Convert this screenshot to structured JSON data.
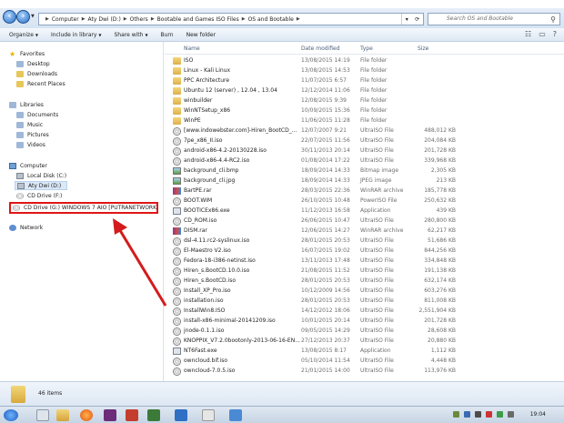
{
  "address": {
    "crumbs": [
      "Computer",
      "Aty Dwi (D:)",
      "Others",
      "Bootable and Games ISO Files",
      "OS and Bootable"
    ],
    "search_placeholder": "Search OS and Bootable"
  },
  "toolbar": {
    "organize": "Organize",
    "include_in_library": "Include in library",
    "share_with": "Share with",
    "burn": "Burn",
    "new_folder": "New folder"
  },
  "nav": {
    "favorites": "Favorites",
    "desktop": "Desktop",
    "downloads": "Downloads",
    "recent_places": "Recent Places",
    "libraries": "Libraries",
    "documents": "Documents",
    "music": "Music",
    "pictures": "Pictures",
    "videos": "Videos",
    "computer": "Computer",
    "local_disk": "Local Disk (C:)",
    "aty_dwi": "Aty Dwi (D:)",
    "cd_drive_f": "CD Drive (F:)",
    "cd_drive_g": "CD Drive (G:) WINDOWS 7 AIO [PUTRANETWORK]",
    "network": "Network"
  },
  "columns": {
    "name": "Name",
    "date": "Date modified",
    "type": "Type",
    "size": "Size"
  },
  "files": [
    {
      "icon": "folder",
      "name": "ISO",
      "date": "13/08/2015 14:19",
      "type": "File folder",
      "size": ""
    },
    {
      "icon": "folder",
      "name": "Linux - Kali Linux",
      "date": "13/08/2015 14:53",
      "type": "File folder",
      "size": ""
    },
    {
      "icon": "folder",
      "name": "PPC Architecture",
      "date": "11/07/2015 6:57",
      "type": "File folder",
      "size": ""
    },
    {
      "icon": "folder",
      "name": "Ubuntu 12 (server) , 12.04 , 13.04",
      "date": "12/12/2014 11:06",
      "type": "File folder",
      "size": ""
    },
    {
      "icon": "folder",
      "name": "winbuilder",
      "date": "12/08/2015 9:39",
      "type": "File folder",
      "size": ""
    },
    {
      "icon": "folder",
      "name": "WinNTSetup_x86",
      "date": "10/09/2015 15:36",
      "type": "File folder",
      "size": ""
    },
    {
      "icon": "folder",
      "name": "WinPE",
      "date": "11/06/2015 11:28",
      "type": "File folder",
      "size": ""
    },
    {
      "icon": "iso",
      "name": "[www.indowebster.com]-Hiren_BootCD_...",
      "date": "12/07/2007 9:21",
      "type": "UltraISO File",
      "size": "488,012 KB"
    },
    {
      "icon": "iso",
      "name": "7pe_x86_II.iso",
      "date": "22/07/2015 11:56",
      "type": "UltraISO File",
      "size": "204,084 KB"
    },
    {
      "icon": "iso",
      "name": "android-x86-4.2-20130228.iso",
      "date": "30/11/2013 20:14",
      "type": "UltraISO File",
      "size": "201,728 KB"
    },
    {
      "icon": "iso",
      "name": "android-x86-4.4-RC2.iso",
      "date": "01/08/2014 17:22",
      "type": "UltraISO File",
      "size": "339,968 KB"
    },
    {
      "icon": "img",
      "name": "background_cli.bmp",
      "date": "18/09/2014 14:33",
      "type": "Bitmap image",
      "size": "2,305 KB"
    },
    {
      "icon": "img",
      "name": "background_cli.jpg",
      "date": "18/09/2014 14:33",
      "type": "JPEG image",
      "size": "213 KB"
    },
    {
      "icon": "rar",
      "name": "BartPE.rar",
      "date": "28/03/2015 22:36",
      "type": "WinRAR archive",
      "size": "185,778 KB"
    },
    {
      "icon": "iso",
      "name": "BOOT.WIM",
      "date": "26/10/2015 10:48",
      "type": "PowerISO File",
      "size": "250,632 KB"
    },
    {
      "icon": "exe",
      "name": "BOOTICEx86.exe",
      "date": "11/12/2013 16:58",
      "type": "Application",
      "size": "439 KB"
    },
    {
      "icon": "iso",
      "name": "CD_ROM.iso",
      "date": "26/06/2015 10:47",
      "type": "UltraISO File",
      "size": "280,800 KB"
    },
    {
      "icon": "rar",
      "name": "DISM.rar",
      "date": "12/06/2015 14:27",
      "type": "WinRAR archive",
      "size": "62,217 KB"
    },
    {
      "icon": "iso",
      "name": "dsl-4.11.rc2-syslinux.iso",
      "date": "28/01/2015 20:53",
      "type": "UltraISO File",
      "size": "51,686 KB"
    },
    {
      "icon": "iso",
      "name": "El-Maestro V2.iso",
      "date": "16/07/2015 19:02",
      "type": "UltraISO File",
      "size": "844,256 KB"
    },
    {
      "icon": "iso",
      "name": "Fedora-18-i386-netinst.iso",
      "date": "13/11/2013 17:48",
      "type": "UltraISO File",
      "size": "334,848 KB"
    },
    {
      "icon": "iso",
      "name": "Hiren_s.BootCD.10.0.iso",
      "date": "21/08/2015 11:52",
      "type": "UltraISO File",
      "size": "191,138 KB"
    },
    {
      "icon": "iso",
      "name": "Hiren_s.BootCD.iso",
      "date": "28/01/2015 20:53",
      "type": "UltraISO File",
      "size": "632,174 KB"
    },
    {
      "icon": "iso",
      "name": "Install_XP_Pro.iso",
      "date": "10/12/2009 14:56",
      "type": "UltraISO File",
      "size": "603,276 KB"
    },
    {
      "icon": "iso",
      "name": "installation.iso",
      "date": "28/01/2015 20:53",
      "type": "UltraISO File",
      "size": "811,008 KB"
    },
    {
      "icon": "iso",
      "name": "InstallWin8.ISO",
      "date": "14/12/2012 18:06",
      "type": "UltraISO File",
      "size": "2,551,904 KB"
    },
    {
      "icon": "iso",
      "name": "install-x86-minimal-20141209.iso",
      "date": "10/01/2015 20:14",
      "type": "UltraISO File",
      "size": "201,728 KB"
    },
    {
      "icon": "iso",
      "name": "jnode-0.1.1.iso",
      "date": "09/05/2015 14:29",
      "type": "UltraISO File",
      "size": "28,608 KB"
    },
    {
      "icon": "iso",
      "name": "KNOPPIX_V7.2.0bootonly-2013-06-16-EN...",
      "date": "27/12/2013 20:37",
      "type": "UltraISO File",
      "size": "20,880 KB"
    },
    {
      "icon": "exe",
      "name": "NT6Fast.exe",
      "date": "13/08/2015 8:17",
      "type": "Application",
      "size": "1,112 KB"
    },
    {
      "icon": "iso",
      "name": "owncloud.bif.iso",
      "date": "05/10/2014 11:54",
      "type": "UltraISO File",
      "size": "4,448 KB"
    },
    {
      "icon": "iso",
      "name": "owncloud-7.0.5.iso",
      "date": "21/01/2015 14:00",
      "type": "UltraISO File",
      "size": "113,976 KB"
    }
  ],
  "details": {
    "count": "46 items"
  },
  "taskbar": {
    "time": "19:04"
  },
  "colors": {
    "highlight": "#e01515",
    "arrow": "#d41b1b"
  }
}
